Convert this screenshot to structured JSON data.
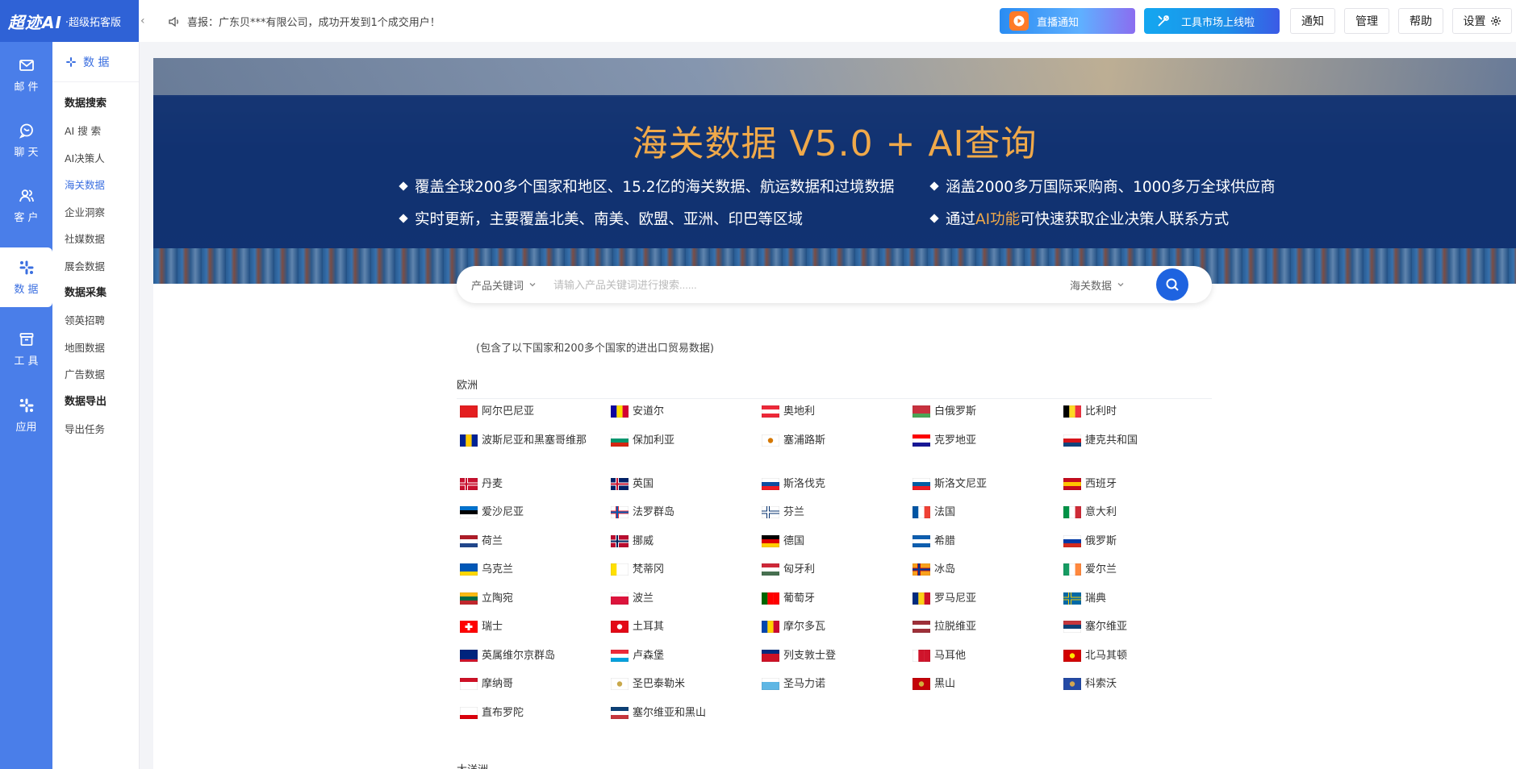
{
  "brand": {
    "logo": "超迹AI",
    "sub": "·超级拓客版"
  },
  "rail": [
    {
      "label": "邮 件",
      "icon": "mail-icon"
    },
    {
      "label": "聊 天",
      "icon": "chat-icon"
    },
    {
      "label": "客 户",
      "icon": "users-icon"
    },
    {
      "label": "数 据",
      "icon": "data-icon"
    },
    {
      "label": "工 具",
      "icon": "tools-icon"
    },
    {
      "label": "应用",
      "icon": "apps-icon"
    }
  ],
  "submenu": {
    "title": "数 据",
    "groups": [
      {
        "title": "数据搜索",
        "items": [
          "AI 搜 索",
          "AI决策人",
          "海关数据",
          "企业洞察",
          "社媒数据",
          "展会数据"
        ]
      },
      {
        "title": "数据采集",
        "items": [
          "领英招聘",
          "地图数据",
          "广告数据"
        ]
      },
      {
        "title": "数据导出",
        "items": [
          "导出任务"
        ]
      }
    ],
    "active": "海关数据"
  },
  "topbar": {
    "notice": "喜报：广东贝***有限公司，成功开发到1个成交用户！",
    "promo1": "直播通知",
    "promo2": "工具市场上线啦",
    "notify": "通知",
    "manage": "管理",
    "help": "帮助",
    "settings": "设置"
  },
  "banner": {
    "title": "海关数据 V5.0 + AI查询",
    "b1": "覆盖全球200多个国家和地区、15.2亿的海关数据、航运数据和过境数据",
    "b2": "涵盖2000多万国际采购商、1000多万全球供应商",
    "b3": "实时更新，主要覆盖北美、南美、欧盟、亚洲、印巴等区域",
    "b4_pre": "通过",
    "b4_hl": "AI功能",
    "b4_post": "可快速获取企业决策人联系方式"
  },
  "search": {
    "keyword_type": "产品关键词",
    "placeholder": "请输入产品关键词进行搜索......",
    "source": "海关数据"
  },
  "description": "(包含了以下国家和200多个国家的进出口贸易数据)",
  "region": "欧洲",
  "countries": [
    {
      "name": "阿尔巴尼亚",
      "flag": [
        "#e41e20",
        "#e41e20",
        "#e41e20"
      ],
      "mode": "solid-emblem"
    },
    {
      "name": "安道尔",
      "flag": [
        "#10069f",
        "#fedd00",
        "#d50032"
      ],
      "mode": "v"
    },
    {
      "name": "奥地利",
      "flag": [
        "#ed2939",
        "#ffffff",
        "#ed2939"
      ],
      "mode": "h"
    },
    {
      "name": "白俄罗斯",
      "flag": [
        "#c8313e",
        "#c8313e",
        "#4aa657"
      ],
      "mode": "h"
    },
    {
      "name": "比利时",
      "flag": [
        "#000000",
        "#fdda24",
        "#ef3340"
      ],
      "mode": "v"
    },
    {
      "name": "波斯尼亚和黑塞哥维那",
      "flag": [
        "#002395",
        "#fecb00",
        "#002395"
      ],
      "mode": "v"
    },
    {
      "name": "保加利亚",
      "flag": [
        "#ffffff",
        "#00966e",
        "#d62612"
      ],
      "mode": "h"
    },
    {
      "name": "塞浦路斯",
      "flag": [
        "#ffffff",
        "#d57800",
        "#ffffff"
      ],
      "mode": "solid-emblem"
    },
    {
      "name": "克罗地亚",
      "flag": [
        "#ff0000",
        "#ffffff",
        "#171796"
      ],
      "mode": "h"
    },
    {
      "name": "捷克共和国",
      "flag": [
        "#ffffff",
        "#d7141a",
        "#11457e"
      ],
      "mode": "h"
    },
    {
      "name": "丹麦",
      "flag": [
        "#c8102e",
        "#ffffff",
        "#c8102e"
      ],
      "mode": "cross"
    },
    {
      "name": "英国",
      "flag": [
        "#012169",
        "#ffffff",
        "#c8102e"
      ],
      "mode": "cross"
    },
    {
      "name": "斯洛伐克",
      "flag": [
        "#ffffff",
        "#0b4ea2",
        "#ee1c25"
      ],
      "mode": "h"
    },
    {
      "name": "斯洛文尼亚",
      "flag": [
        "#ffffff",
        "#005da4",
        "#ed1c24"
      ],
      "mode": "h"
    },
    {
      "name": "西班牙",
      "flag": [
        "#c60b1e",
        "#ffc400",
        "#c60b1e"
      ],
      "mode": "h"
    },
    {
      "name": "爱沙尼亚",
      "flag": [
        "#0072ce",
        "#000000",
        "#ffffff"
      ],
      "mode": "h"
    },
    {
      "name": "法罗群岛",
      "flag": [
        "#ffffff",
        "#ed2939",
        "#005eb8"
      ],
      "mode": "cross"
    },
    {
      "name": "芬兰",
      "flag": [
        "#ffffff",
        "#002f6c",
        "#ffffff"
      ],
      "mode": "cross"
    },
    {
      "name": "法国",
      "flag": [
        "#0055a4",
        "#ffffff",
        "#ef4135"
      ],
      "mode": "v"
    },
    {
      "name": "意大利",
      "flag": [
        "#009246",
        "#ffffff",
        "#ce2b37"
      ],
      "mode": "v"
    },
    {
      "name": "荷兰",
      "flag": [
        "#ae1c28",
        "#ffffff",
        "#21468b"
      ],
      "mode": "h"
    },
    {
      "name": "挪威",
      "flag": [
        "#ba0c2f",
        "#ffffff",
        "#00205b"
      ],
      "mode": "cross"
    },
    {
      "name": "德国",
      "flag": [
        "#000000",
        "#dd0000",
        "#ffce00"
      ],
      "mode": "h"
    },
    {
      "name": "希腊",
      "flag": [
        "#0d5eaf",
        "#ffffff",
        "#0d5eaf"
      ],
      "mode": "h"
    },
    {
      "name": "俄罗斯",
      "flag": [
        "#ffffff",
        "#0039a6",
        "#d52b1e"
      ],
      "mode": "h"
    },
    {
      "name": "乌克兰",
      "flag": [
        "#0057b7",
        "#0057b7",
        "#ffd700"
      ],
      "mode": "h"
    },
    {
      "name": "梵蒂冈",
      "flag": [
        "#ffe000",
        "#ffffff",
        "#ffffff"
      ],
      "mode": "v"
    },
    {
      "name": "匈牙利",
      "flag": [
        "#ce2939",
        "#ffffff",
        "#477050"
      ],
      "mode": "h"
    },
    {
      "name": "冰岛",
      "flag": [
        "#f9a11b",
        "#b5121b",
        "#003897"
      ],
      "mode": "cross"
    },
    {
      "name": "爱尔兰",
      "flag": [
        "#169b62",
        "#ffffff",
        "#ff883e"
      ],
      "mode": "v"
    },
    {
      "name": "立陶宛",
      "flag": [
        "#fdb913",
        "#006a44",
        "#c1272d"
      ],
      "mode": "h"
    },
    {
      "name": "波兰",
      "flag": [
        "#ffffff",
        "#dc143c",
        "#dc143c"
      ],
      "mode": "h"
    },
    {
      "name": "葡萄牙",
      "flag": [
        "#006600",
        "#ff0000",
        "#ff0000"
      ],
      "mode": "v"
    },
    {
      "name": "罗马尼亚",
      "flag": [
        "#002b7f",
        "#fcd116",
        "#ce1126"
      ],
      "mode": "v"
    },
    {
      "name": "瑞典",
      "flag": [
        "#006aa7",
        "#fecc00",
        "#006aa7"
      ],
      "mode": "cross"
    },
    {
      "name": "瑞士",
      "flag": [
        "#ff0000",
        "#ffffff",
        "#ff0000"
      ],
      "mode": "swiss"
    },
    {
      "name": "土耳其",
      "flag": [
        "#e30a17",
        "#ffffff",
        "#e30a17"
      ],
      "mode": "solid-emblem"
    },
    {
      "name": "摩尔多瓦",
      "flag": [
        "#0046ae",
        "#ffd200",
        "#cc092f"
      ],
      "mode": "v"
    },
    {
      "name": "拉脱维亚",
      "flag": [
        "#9e3039",
        "#ffffff",
        "#9e3039"
      ],
      "mode": "h"
    },
    {
      "name": "塞尔维亚",
      "flag": [
        "#c6363c",
        "#0c4076",
        "#ffffff"
      ],
      "mode": "h"
    },
    {
      "name": "英属维尔京群岛",
      "flag": [
        "#00247d",
        "#00247d",
        "#cf142b"
      ],
      "mode": "solid-emblem"
    },
    {
      "name": "卢森堡",
      "flag": [
        "#ed2939",
        "#ffffff",
        "#00a1de"
      ],
      "mode": "h"
    },
    {
      "name": "列支敦士登",
      "flag": [
        "#002b7f",
        "#ce1126",
        "#ce1126"
      ],
      "mode": "h"
    },
    {
      "name": "马耳他",
      "flag": [
        "#ffffff",
        "#cf142b",
        "#cf142b"
      ],
      "mode": "v"
    },
    {
      "name": "北马其顿",
      "flag": [
        "#d20000",
        "#ffe600",
        "#d20000"
      ],
      "mode": "solid-emblem"
    },
    {
      "name": "摩纳哥",
      "flag": [
        "#ce1126",
        "#ffffff",
        "#ffffff"
      ],
      "mode": "h"
    },
    {
      "name": "圣巴泰勒米",
      "flag": [
        "#ffffff",
        "#c8a84b",
        "#ffffff"
      ],
      "mode": "solid-emblem"
    },
    {
      "name": "圣马力诺",
      "flag": [
        "#ffffff",
        "#5eb6e4",
        "#5eb6e4"
      ],
      "mode": "h"
    },
    {
      "name": "黑山",
      "flag": [
        "#c40308",
        "#d3ae3b",
        "#c40308"
      ],
      "mode": "solid-emblem"
    },
    {
      "name": "科索沃",
      "flag": [
        "#244aa5",
        "#d0a650",
        "#244aa5"
      ],
      "mode": "solid-emblem"
    },
    {
      "name": "直布罗陀",
      "flag": [
        "#ffffff",
        "#ffffff",
        "#da000c"
      ],
      "mode": "h"
    },
    {
      "name": "塞尔维亚和黑山",
      "flag": [
        "#0c4076",
        "#ffffff",
        "#c6363c"
      ],
      "mode": "h"
    }
  ],
  "next_region": "大洋洲",
  "colors": {
    "rail": "#4a7ee9",
    "brand": "#2f62d6",
    "accent": "#3b6fe0",
    "banner_title": "#f0a94a"
  }
}
